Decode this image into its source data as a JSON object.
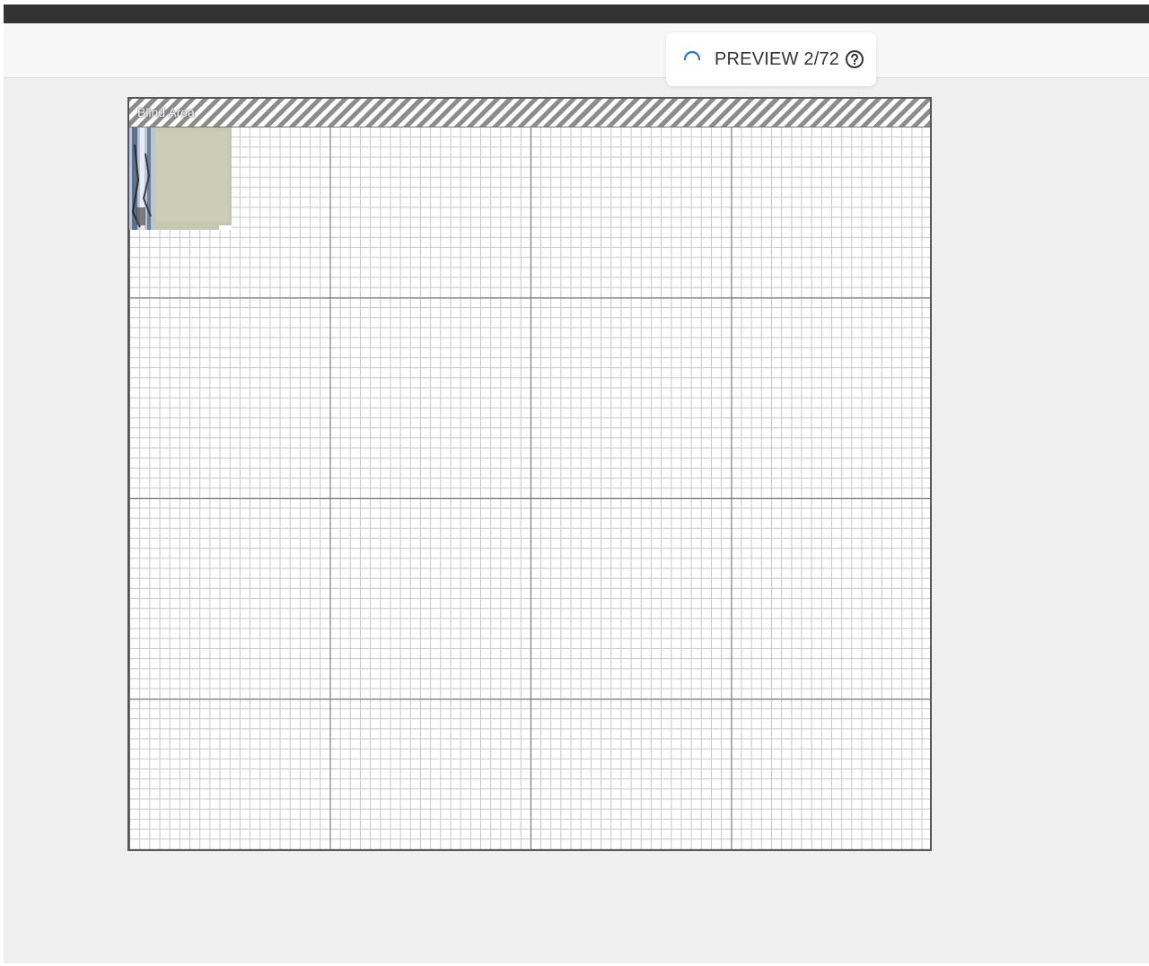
{
  "preview": {
    "label": "PREVIEW 2/72",
    "spinner_icon": "loading-spinner-icon",
    "help_icon": "question-circle-icon",
    "spinner_color": "#2f6fd6"
  },
  "canvas": {
    "blind_area_label": "Blind Area"
  },
  "colors": {
    "titlebar": "#333333",
    "background": "#efefef",
    "toolbar": "#f7f7f7"
  }
}
